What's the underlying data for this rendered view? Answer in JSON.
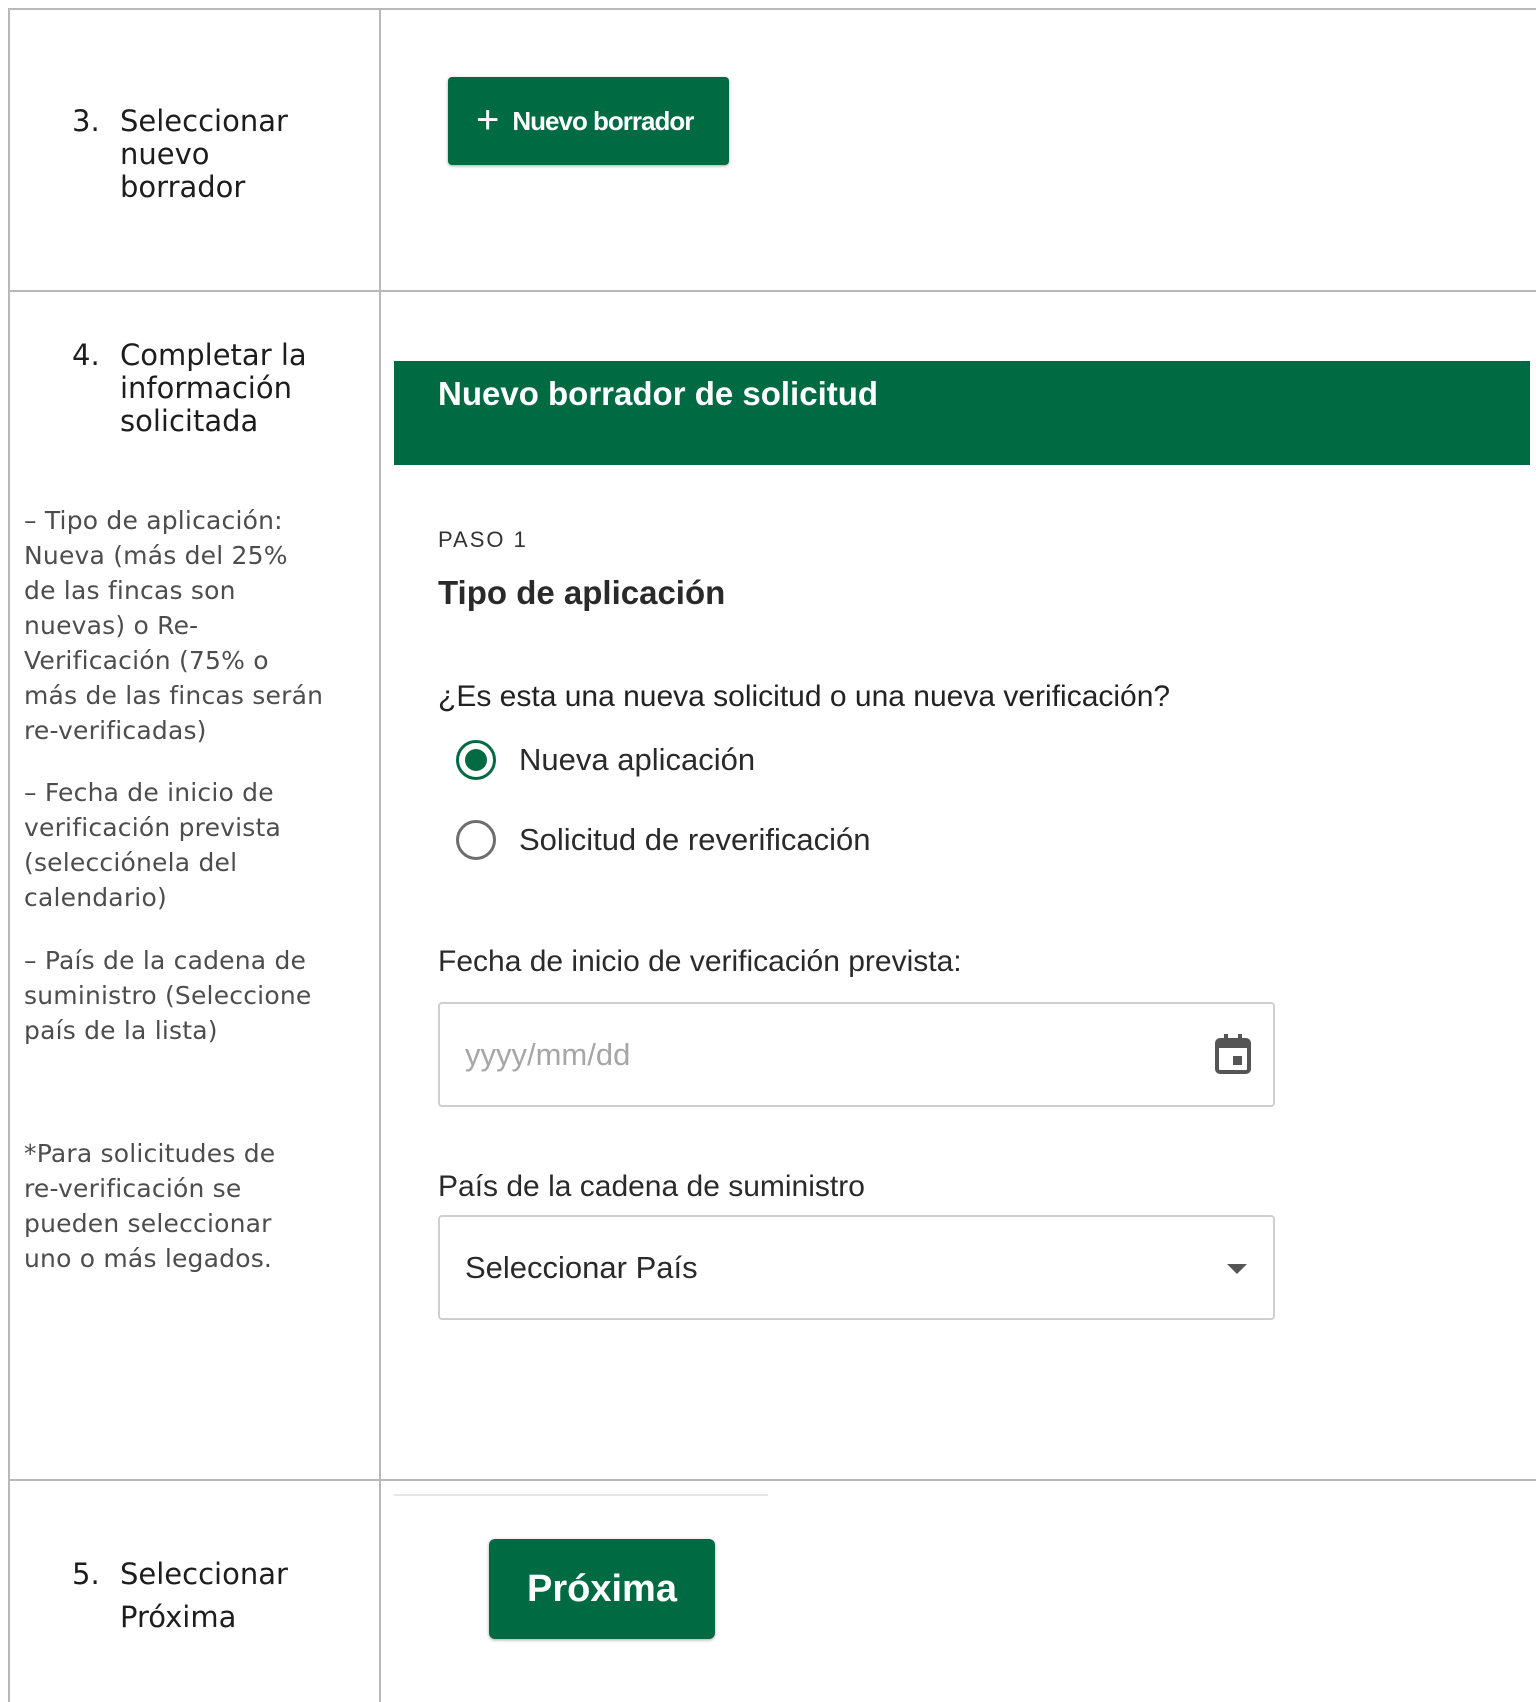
{
  "steps": [
    {
      "num": "3.",
      "text": "Seleccionar nuevo borrador"
    },
    {
      "num": "4.",
      "text": "Completar la información solicitada"
    },
    {
      "num": "5.",
      "text": "Seleccionar Próxima"
    }
  ],
  "notes": {
    "tipo": "– Tipo de aplicación: Nueva (más del 25% de las fincas son nuevas) o Re-Verificación (75% o más de las fincas serán re-verificadas)",
    "fecha": "– Fecha de inicio de verificación prevista (selecciónela del calendario)",
    "pais": "– País de la cadena de suministro (Seleccione país de la lista)",
    "legados": "*Para solicitudes de re-verificación se pueden seleccionar uno o más legados."
  },
  "buttons": {
    "new_draft": "Nuevo borrador",
    "next": "Próxima"
  },
  "form": {
    "header": "Nuevo borrador de solicitud",
    "step_label": "PASO 1",
    "section_title": "Tipo de aplicación",
    "question": "¿Es esta una nueva solicitud o una nueva verificación?",
    "options": [
      {
        "label": "Nueva aplicación",
        "selected": true
      },
      {
        "label": "Solicitud de reverificación",
        "selected": false
      }
    ],
    "date_label": "Fecha de inicio de verificación prevista:",
    "date_placeholder": "yyyy/mm/dd",
    "country_label": "País de la cadena de suministro",
    "country_value": "Seleccionar País"
  },
  "colors": {
    "brand_green": "#006b43",
    "grid": "#b8b8b8"
  },
  "icons": [
    "plus-icon",
    "calendar-icon",
    "dropdown-caret-icon"
  ]
}
